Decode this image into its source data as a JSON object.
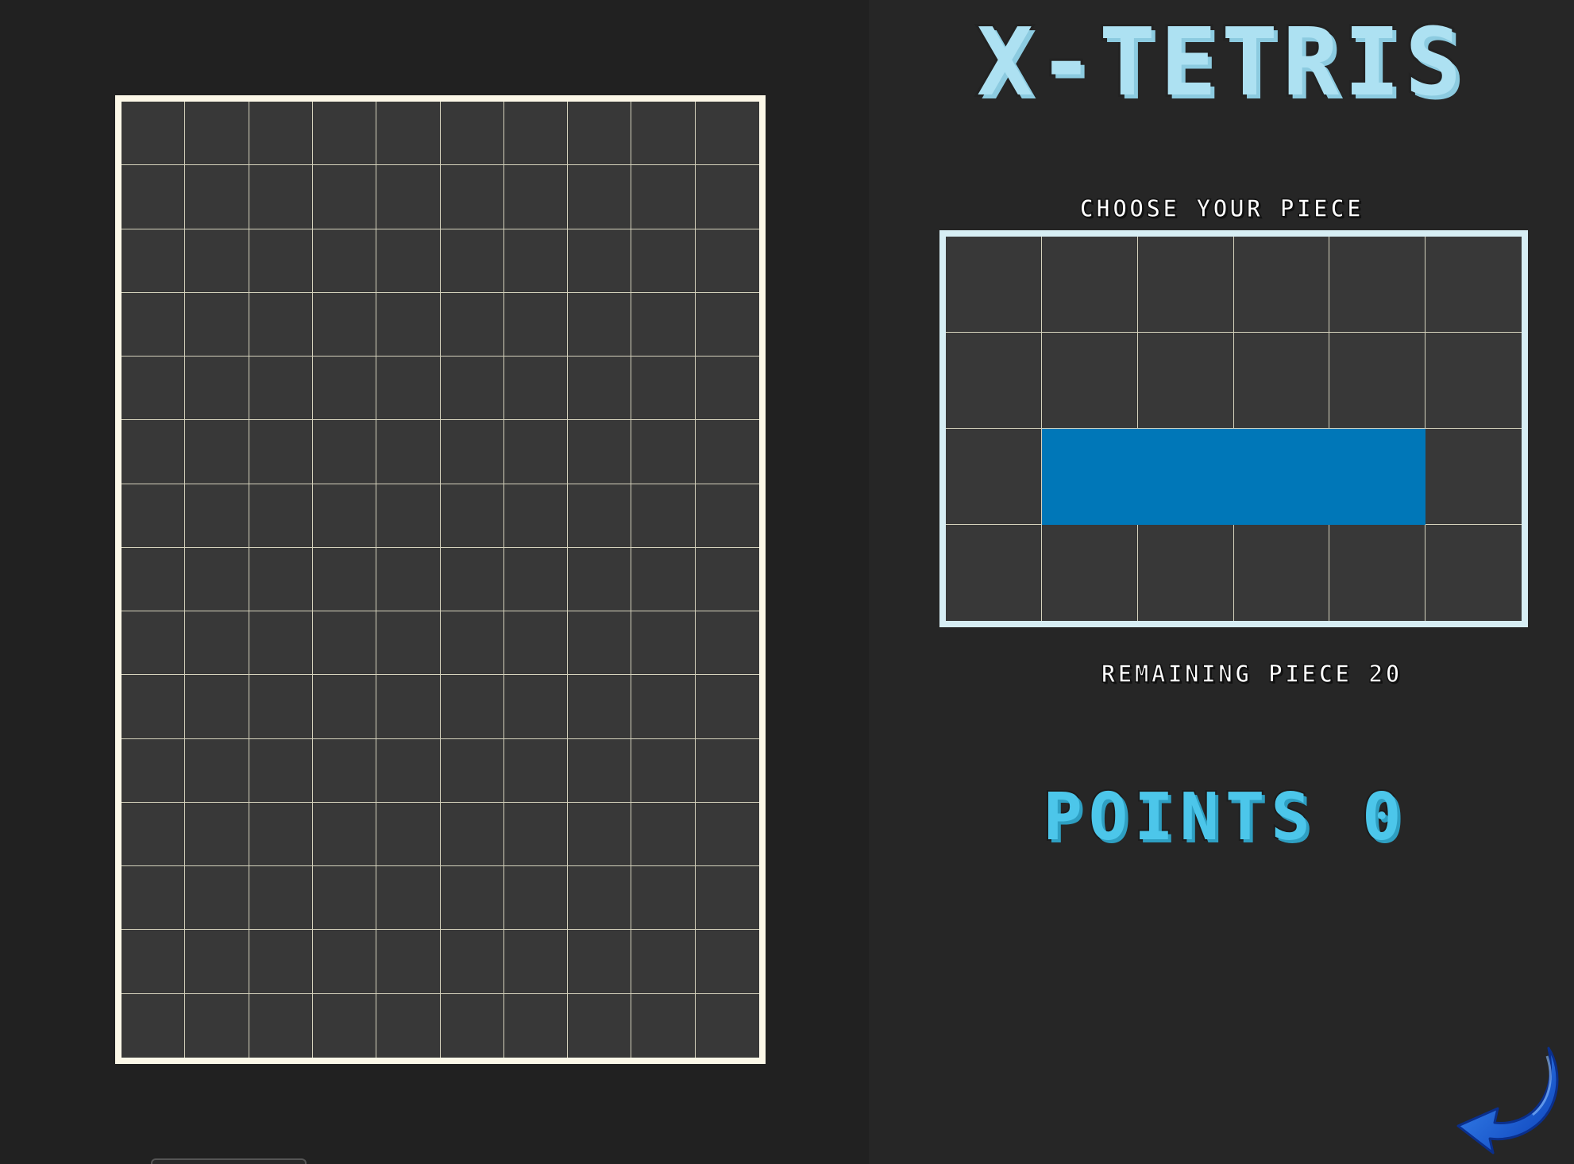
{
  "game": {
    "title": "X-TETRIS",
    "choose_label": "CHOOSE YOUR PIECE",
    "remaining_label": "REMAINING PIECE 20",
    "points_label": "POINTS 0"
  },
  "board": {
    "columns": 10,
    "rows": 15,
    "filled_cells": []
  },
  "preview": {
    "columns": 6,
    "rows": 4,
    "piece": "I",
    "piece_color": "#0077b8",
    "filled_cells": [
      [
        2,
        1
      ],
      [
        2,
        2
      ],
      [
        2,
        3
      ],
      [
        2,
        4
      ]
    ]
  },
  "colors": {
    "background": "#222222",
    "board_border": "#fcf8e8",
    "preview_border": "#d7eef4",
    "title": "#ade1f2",
    "points": "#4cc6ea",
    "cell": "#383838",
    "grid_line": "#d6d3bd"
  },
  "icons": {
    "back": "curved-back-arrow-icon"
  }
}
